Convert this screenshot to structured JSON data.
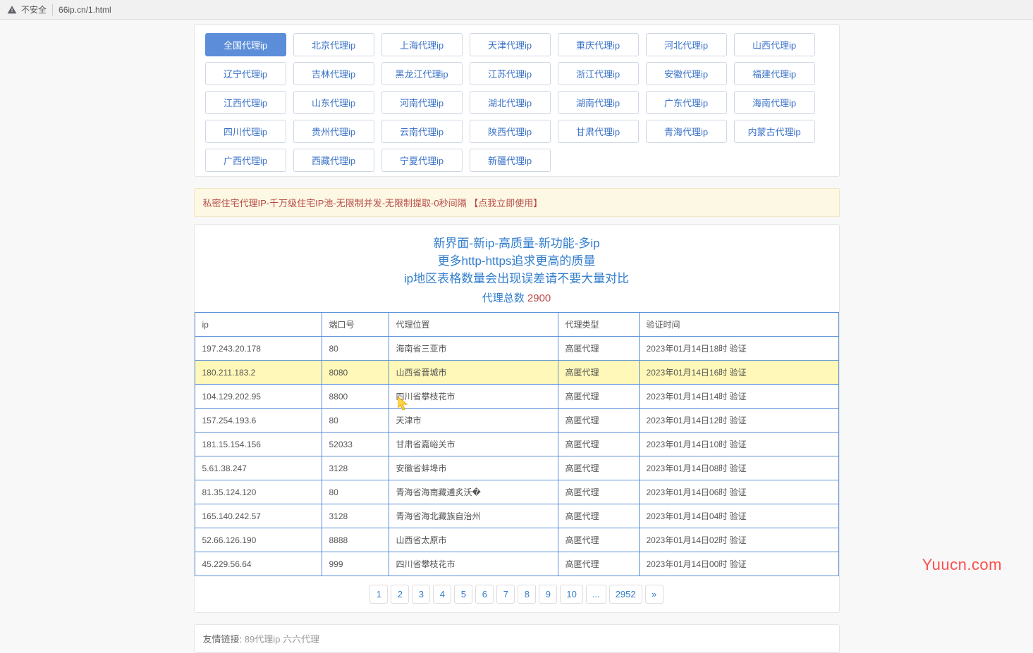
{
  "browser": {
    "security_label": "不安全",
    "url": "66ip.cn/1.html"
  },
  "regions": [
    {
      "label": "全国代理ip",
      "active": true
    },
    {
      "label": "北京代理ip"
    },
    {
      "label": "上海代理ip"
    },
    {
      "label": "天津代理ip"
    },
    {
      "label": "重庆代理ip"
    },
    {
      "label": "河北代理ip"
    },
    {
      "label": "山西代理ip"
    },
    {
      "label": "辽宁代理ip"
    },
    {
      "label": "吉林代理ip"
    },
    {
      "label": "黑龙江代理ip"
    },
    {
      "label": "江苏代理ip"
    },
    {
      "label": "浙江代理ip"
    },
    {
      "label": "安徽代理ip"
    },
    {
      "label": "福建代理ip"
    },
    {
      "label": "江西代理ip"
    },
    {
      "label": "山东代理ip"
    },
    {
      "label": "河南代理ip"
    },
    {
      "label": "湖北代理ip"
    },
    {
      "label": "湖南代理ip"
    },
    {
      "label": "广东代理ip"
    },
    {
      "label": "海南代理ip"
    },
    {
      "label": "四川代理ip"
    },
    {
      "label": "贵州代理ip"
    },
    {
      "label": "云南代理ip"
    },
    {
      "label": "陕西代理ip"
    },
    {
      "label": "甘肃代理ip"
    },
    {
      "label": "青海代理ip"
    },
    {
      "label": "内蒙古代理ip"
    },
    {
      "label": "广西代理ip"
    },
    {
      "label": "西藏代理ip"
    },
    {
      "label": "宁夏代理ip"
    },
    {
      "label": "新疆代理ip"
    }
  ],
  "notice": "私密住宅代理IP-千万级住宅IP池-无限制并发-无限制提取-0秒间隔 【点我立即使用】",
  "info": {
    "line1": "新界面-新ip-高质量-新功能-多ip",
    "line2": "更多http-https追求更高的质量",
    "line3": "ip地区表格数量会出现误差请不要大量对比",
    "total_label": "代理总数",
    "total_value": "2900"
  },
  "table": {
    "headers": [
      "ip",
      "端口号",
      "代理位置",
      "代理类型",
      "验证时间"
    ],
    "rows": [
      {
        "ip": "197.243.20.178",
        "port": "80",
        "loc": "海南省三亚市",
        "type": "高匿代理",
        "time": "2023年01月14日18时 验证"
      },
      {
        "ip": "180.211.183.2",
        "port": "8080",
        "loc": "山西省晋城市",
        "type": "高匿代理",
        "time": "2023年01月14日16时 验证",
        "highlight": true
      },
      {
        "ip": "104.129.202.95",
        "port": "8800",
        "loc": "四川省攀枝花市",
        "type": "高匿代理",
        "time": "2023年01月14日14时 验证",
        "cursor_on_loc": true
      },
      {
        "ip": "157.254.193.6",
        "port": "80",
        "loc": "天津市",
        "type": "高匿代理",
        "time": "2023年01月14日12时 验证"
      },
      {
        "ip": "181.15.154.156",
        "port": "52033",
        "loc": "甘肃省嘉峪关市",
        "type": "高匿代理",
        "time": "2023年01月14日10时 验证"
      },
      {
        "ip": "5.61.38.247",
        "port": "3128",
        "loc": "安徽省蚌埠市",
        "type": "高匿代理",
        "time": "2023年01月14日08时 验证"
      },
      {
        "ip": "81.35.124.120",
        "port": "80",
        "loc": "青海省海南藏逋炙沃�",
        "type": "高匿代理",
        "time": "2023年01月14日06时 验证"
      },
      {
        "ip": "165.140.242.57",
        "port": "3128",
        "loc": "青海省海北藏族自治州",
        "type": "高匿代理",
        "time": "2023年01月14日04时 验证"
      },
      {
        "ip": "52.66.126.190",
        "port": "8888",
        "loc": "山西省太原市",
        "type": "高匿代理",
        "time": "2023年01月14日02时 验证"
      },
      {
        "ip": "45.229.56.64",
        "port": "999",
        "loc": "四川省攀枝花市",
        "type": "高匿代理",
        "time": "2023年01月14日00时 验证"
      }
    ]
  },
  "pagination": [
    "1",
    "2",
    "3",
    "4",
    "5",
    "6",
    "7",
    "8",
    "9",
    "10",
    "...",
    "2952",
    "»"
  ],
  "friend": {
    "label": "友情链接:",
    "links": "89代理ip 六六代理"
  },
  "watermark": "Yuucn.com"
}
